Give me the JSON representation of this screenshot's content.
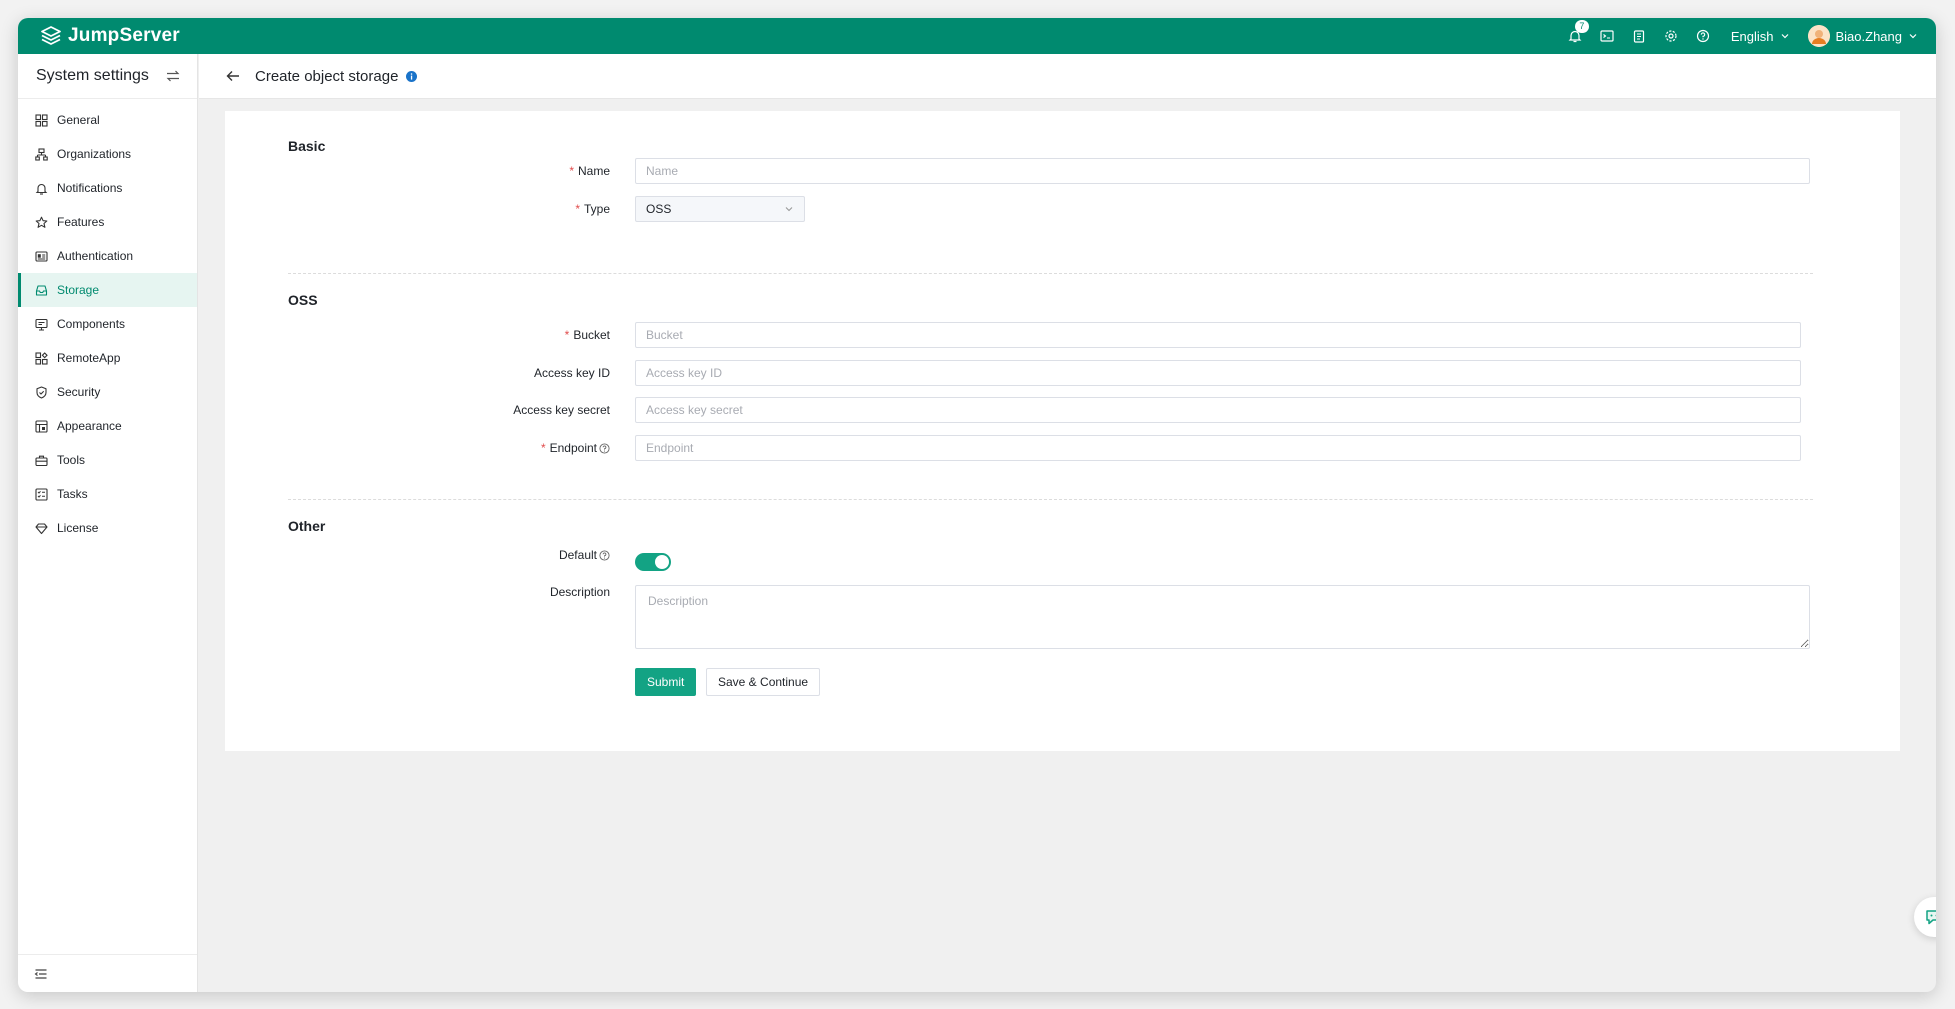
{
  "topbar": {
    "brand": "JumpServer",
    "notification_count": "7",
    "language": "English",
    "username": "Biao.Zhang"
  },
  "sidebar": {
    "title": "System settings",
    "items": [
      {
        "label": "General",
        "icon": "grid-icon"
      },
      {
        "label": "Organizations",
        "icon": "org-icon"
      },
      {
        "label": "Notifications",
        "icon": "bell-icon"
      },
      {
        "label": "Features",
        "icon": "star-icon"
      },
      {
        "label": "Authentication",
        "icon": "id-card-icon"
      },
      {
        "label": "Storage",
        "icon": "storage-icon",
        "active": true
      },
      {
        "label": "Components",
        "icon": "monitor-icon"
      },
      {
        "label": "RemoteApp",
        "icon": "apps-icon"
      },
      {
        "label": "Security",
        "icon": "shield-icon"
      },
      {
        "label": "Appearance",
        "icon": "palette-icon"
      },
      {
        "label": "Tools",
        "icon": "toolbox-icon"
      },
      {
        "label": "Tasks",
        "icon": "tasks-icon"
      },
      {
        "label": "License",
        "icon": "diamond-icon"
      }
    ]
  },
  "page": {
    "title": "Create object storage"
  },
  "form": {
    "basic": {
      "title": "Basic",
      "name_label": "Name",
      "name_placeholder": "Name",
      "type_label": "Type",
      "type_value": "OSS"
    },
    "oss": {
      "title": "OSS",
      "bucket_label": "Bucket",
      "bucket_placeholder": "Bucket",
      "access_key_id_label": "Access key ID",
      "access_key_id_placeholder": "Access key ID",
      "access_key_secret_label": "Access key secret",
      "access_key_secret_placeholder": "Access key secret",
      "endpoint_label": "Endpoint",
      "endpoint_placeholder": "Endpoint"
    },
    "other": {
      "title": "Other",
      "default_label": "Default",
      "default_on": true,
      "description_label": "Description",
      "description_placeholder": "Description"
    },
    "actions": {
      "submit": "Submit",
      "save_continue": "Save & Continue"
    }
  },
  "colors": {
    "brand": "#008a6f",
    "primary_button": "#13a384",
    "required": "#e14c4c"
  }
}
